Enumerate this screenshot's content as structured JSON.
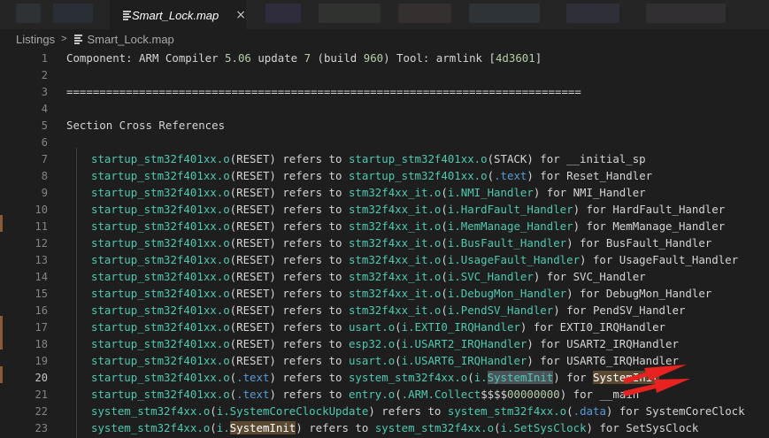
{
  "tab": {
    "title": "Smart_Lock.map",
    "close": "×",
    "icon": "file-lines-icon"
  },
  "breadcrumb": {
    "root": "Listings",
    "separator": ">",
    "file": "Smart_Lock.map"
  },
  "lines": [
    {
      "n": "1",
      "parts": [
        {
          "t": "Component: ARM Compiler "
        },
        {
          "t": "5.06",
          "c": "num"
        },
        {
          "t": " update "
        },
        {
          "t": "7",
          "c": "num"
        },
        {
          "t": " (build "
        },
        {
          "t": "960",
          "c": "num"
        },
        {
          "t": ") Tool: armlink ["
        },
        {
          "t": "4d3601",
          "c": "num"
        },
        {
          "t": "]"
        }
      ]
    },
    {
      "n": "2",
      "parts": []
    },
    {
      "n": "3",
      "parts": [
        {
          "t": "=============================================================================="
        }
      ]
    },
    {
      "n": "4",
      "parts": []
    },
    {
      "n": "5",
      "parts": [
        {
          "t": "Section Cross References"
        }
      ]
    },
    {
      "n": "6",
      "parts": []
    },
    {
      "n": "7",
      "indent": true,
      "parts": [
        {
          "t": "startup_stm32f401xx.o",
          "c": "kw"
        },
        {
          "t": "(RESET) refers to "
        },
        {
          "t": "startup_stm32f401xx.o",
          "c": "kw"
        },
        {
          "t": "(STACK) for __initial_sp"
        }
      ]
    },
    {
      "n": "8",
      "indent": true,
      "parts": [
        {
          "t": "startup_stm32f401xx.o",
          "c": "kw"
        },
        {
          "t": "(RESET) refers to "
        },
        {
          "t": "startup_stm32f401xx.o",
          "c": "kw"
        },
        {
          "t": "("
        },
        {
          "t": ".text",
          "c": "lnk"
        },
        {
          "t": ") for Reset_Handler"
        }
      ]
    },
    {
      "n": "9",
      "indent": true,
      "parts": [
        {
          "t": "startup_stm32f401xx.o",
          "c": "kw"
        },
        {
          "t": "(RESET) refers to "
        },
        {
          "t": "stm32f4xx_it.o",
          "c": "kw"
        },
        {
          "t": "("
        },
        {
          "t": "i.NMI_Handler",
          "c": "kw"
        },
        {
          "t": ") for NMI_Handler"
        }
      ]
    },
    {
      "n": "10",
      "indent": true,
      "parts": [
        {
          "t": "startup_stm32f401xx.o",
          "c": "kw"
        },
        {
          "t": "(RESET) refers to "
        },
        {
          "t": "stm32f4xx_it.o",
          "c": "kw"
        },
        {
          "t": "("
        },
        {
          "t": "i.HardFault_Handler",
          "c": "kw"
        },
        {
          "t": ") for HardFault_Handler"
        }
      ]
    },
    {
      "n": "11",
      "indent": true,
      "parts": [
        {
          "t": "startup_stm32f401xx.o",
          "c": "kw"
        },
        {
          "t": "(RESET) refers to "
        },
        {
          "t": "stm32f4xx_it.o",
          "c": "kw"
        },
        {
          "t": "("
        },
        {
          "t": "i.MemManage_Handler",
          "c": "kw"
        },
        {
          "t": ") for MemManage_Handler"
        }
      ]
    },
    {
      "n": "12",
      "indent": true,
      "parts": [
        {
          "t": "startup_stm32f401xx.o",
          "c": "kw"
        },
        {
          "t": "(RESET) refers to "
        },
        {
          "t": "stm32f4xx_it.o",
          "c": "kw"
        },
        {
          "t": "("
        },
        {
          "t": "i.BusFault_Handler",
          "c": "kw"
        },
        {
          "t": ") for BusFault_Handler"
        }
      ]
    },
    {
      "n": "13",
      "indent": true,
      "parts": [
        {
          "t": "startup_stm32f401xx.o",
          "c": "kw"
        },
        {
          "t": "(RESET) refers to "
        },
        {
          "t": "stm32f4xx_it.o",
          "c": "kw"
        },
        {
          "t": "("
        },
        {
          "t": "i.UsageFault_Handler",
          "c": "kw"
        },
        {
          "t": ") for UsageFault_Handler"
        }
      ]
    },
    {
      "n": "14",
      "indent": true,
      "parts": [
        {
          "t": "startup_stm32f401xx.o",
          "c": "kw"
        },
        {
          "t": "(RESET) refers to "
        },
        {
          "t": "stm32f4xx_it.o",
          "c": "kw"
        },
        {
          "t": "("
        },
        {
          "t": "i.SVC_Handler",
          "c": "kw"
        },
        {
          "t": ") for SVC_Handler"
        }
      ]
    },
    {
      "n": "15",
      "indent": true,
      "parts": [
        {
          "t": "startup_stm32f401xx.o",
          "c": "kw"
        },
        {
          "t": "(RESET) refers to "
        },
        {
          "t": "stm32f4xx_it.o",
          "c": "kw"
        },
        {
          "t": "("
        },
        {
          "t": "i.DebugMon_Handler",
          "c": "kw"
        },
        {
          "t": ") for DebugMon_Handler"
        }
      ]
    },
    {
      "n": "16",
      "indent": true,
      "parts": [
        {
          "t": "startup_stm32f401xx.o",
          "c": "kw"
        },
        {
          "t": "(RESET) refers to "
        },
        {
          "t": "stm32f4xx_it.o",
          "c": "kw"
        },
        {
          "t": "("
        },
        {
          "t": "i.PendSV_Handler",
          "c": "kw"
        },
        {
          "t": ") for PendSV_Handler"
        }
      ]
    },
    {
      "n": "17",
      "indent": true,
      "parts": [
        {
          "t": "startup_stm32f401xx.o",
          "c": "kw"
        },
        {
          "t": "(RESET) refers to "
        },
        {
          "t": "usart.o",
          "c": "kw"
        },
        {
          "t": "("
        },
        {
          "t": "i.EXTI0_IRQHandler",
          "c": "kw"
        },
        {
          "t": ") for EXTI0_IRQHandler"
        }
      ]
    },
    {
      "n": "18",
      "indent": true,
      "parts": [
        {
          "t": "startup_stm32f401xx.o",
          "c": "kw"
        },
        {
          "t": "(RESET) refers to "
        },
        {
          "t": "esp32.o",
          "c": "kw"
        },
        {
          "t": "("
        },
        {
          "t": "i.USART2_IRQHandler",
          "c": "kw"
        },
        {
          "t": ") for USART2_IRQHandler"
        }
      ]
    },
    {
      "n": "19",
      "indent": true,
      "parts": [
        {
          "t": "startup_stm32f401xx.o",
          "c": "kw"
        },
        {
          "t": "(RESET) refers to "
        },
        {
          "t": "usart.o",
          "c": "kw"
        },
        {
          "t": "("
        },
        {
          "t": "i.USART6_IRQHandler",
          "c": "kw"
        },
        {
          "t": ") for USART6_IRQHandler"
        }
      ]
    },
    {
      "n": "20",
      "indent": true,
      "active": true,
      "parts": [
        {
          "t": "startup_stm32f401xx.o",
          "c": "kw"
        },
        {
          "t": "("
        },
        {
          "t": ".text",
          "c": "lnk"
        },
        {
          "t": ") refers to "
        },
        {
          "t": "system_stm32f4xx.o",
          "c": "kw"
        },
        {
          "t": "("
        },
        {
          "t": "i.",
          "c": "kw"
        },
        {
          "t": "SystemInit",
          "c": "kw hl"
        },
        {
          "t": ") for "
        },
        {
          "t": "SystemInit",
          "c": "hl2"
        }
      ]
    },
    {
      "n": "21",
      "indent": true,
      "parts": [
        {
          "t": "startup_stm32f401xx.o",
          "c": "kw"
        },
        {
          "t": "("
        },
        {
          "t": ".text",
          "c": "lnk"
        },
        {
          "t": ") refers to "
        },
        {
          "t": "entry.o",
          "c": "kw"
        },
        {
          "t": "("
        },
        {
          "t": ".ARM.Collect",
          "c": "kw"
        },
        {
          "t": "$$$$"
        },
        {
          "t": "00000000",
          "c": "num"
        },
        {
          "t": ") for __main"
        }
      ]
    },
    {
      "n": "22",
      "indent": true,
      "parts": [
        {
          "t": "system_stm32f4xx.o",
          "c": "kw"
        },
        {
          "t": "("
        },
        {
          "t": "i.SystemCoreClockUpdate",
          "c": "kw"
        },
        {
          "t": ") refers to "
        },
        {
          "t": "system_stm32f4xx.o",
          "c": "kw"
        },
        {
          "t": "("
        },
        {
          "t": ".data",
          "c": "lnk"
        },
        {
          "t": ") for SystemCoreClock"
        }
      ]
    },
    {
      "n": "23",
      "indent": true,
      "parts": [
        {
          "t": "system_stm32f4xx.o",
          "c": "kw"
        },
        {
          "t": "("
        },
        {
          "t": "i.",
          "c": "kw"
        },
        {
          "t": "SystemInit",
          "c": "kw hl2"
        },
        {
          "t": ") refers to "
        },
        {
          "t": "system_stm32f4xx.o",
          "c": "kw"
        },
        {
          "t": "("
        },
        {
          "t": "i.SetSysClock",
          "c": "kw"
        },
        {
          "t": ") for SetSysClock"
        }
      ]
    }
  ],
  "colors": {
    "keyword": "#4ec9b0",
    "number": "#b5cea8",
    "link": "#569cd6",
    "arrow": "#e8231f"
  }
}
